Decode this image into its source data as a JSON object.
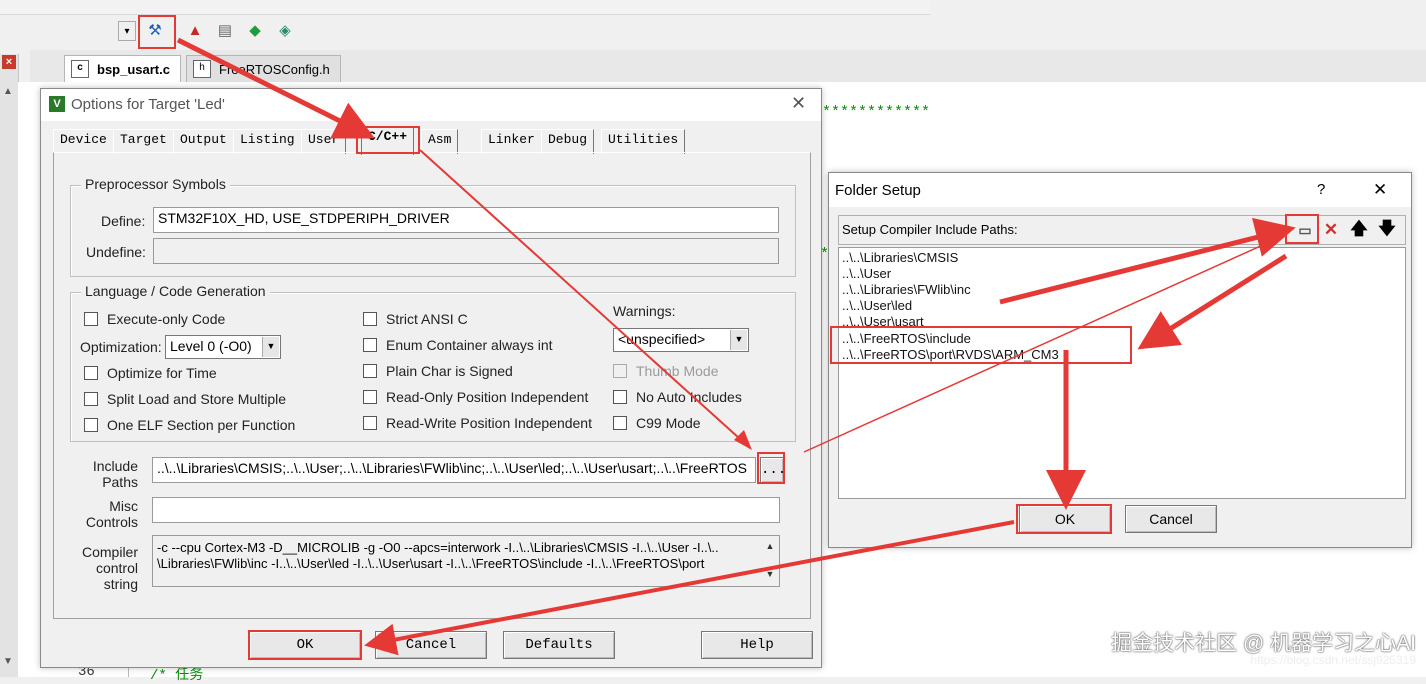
{
  "colors": {
    "annotation_red": "#e53935",
    "comment_green": "#0a8a0a",
    "dialog_bg": "#f0f0f0"
  },
  "toolbar": {
    "icons": [
      "magic-wand-icon",
      "load-icon",
      "layers-icon",
      "green-diamond-icon",
      "manage-packs-icon"
    ]
  },
  "editor_tabs": [
    {
      "label": "bsp_usart.c",
      "active": true
    },
    {
      "label": "FreeRTOSConfig.h",
      "active": false
    }
  ],
  "editor": {
    "stars_line_1": "************",
    "stars_line_2": "*",
    "line_number": "36",
    "comment_text": "/* 任务"
  },
  "options_dialog": {
    "title": "Options for Target 'Led'",
    "tabs": [
      "Device",
      "Target",
      "Output",
      "Listing",
      "User",
      "C/C++",
      "Asm",
      "Linker",
      "Debug",
      "Utilities"
    ],
    "active_tab": "C/C++",
    "preprocessor": {
      "group_title": "Preprocessor Symbols",
      "define_label": "Define:",
      "define_value": "STM32F10X_HD, USE_STDPERIPH_DRIVER",
      "undefine_label": "Undefine:",
      "undefine_value": ""
    },
    "language": {
      "group_title": "Language / Code Generation",
      "execute_only": "Execute-only Code",
      "optimization_label": "Optimization:",
      "optimization_value": "Level 0 (-O0)",
      "optimize_time": "Optimize for Time",
      "split_load": "Split Load and Store Multiple",
      "one_elf": "One ELF Section per Function",
      "strict_ansi": "Strict ANSI C",
      "enum_container": "Enum Container always int",
      "plain_char": "Plain Char is Signed",
      "ro_pi": "Read-Only Position Independent",
      "rw_pi": "Read-Write Position Independent",
      "warnings_label": "Warnings:",
      "warnings_value": "<unspecified>",
      "thumb_mode": "Thumb Mode",
      "no_auto_includes": "No Auto Includes",
      "c99_mode": "C99 Mode"
    },
    "include_paths_label_1": "Include",
    "include_paths_label_2": "Paths",
    "include_paths_value": "..\\..\\Libraries\\CMSIS;..\\..\\User;..\\..\\Libraries\\FWlib\\inc;..\\..\\User\\led;..\\..\\User\\usart;..\\..\\FreeRTOS",
    "browse_label": "...",
    "misc_label_1": "Misc",
    "misc_label_2": "Controls",
    "misc_value": "",
    "compiler_label_1": "Compiler",
    "compiler_label_2": "control",
    "compiler_label_3": "string",
    "compiler_line_1": "-c --cpu Cortex-M3 -D__MICROLIB -g -O0 --apcs=interwork -I..\\..\\Libraries\\CMSIS -I..\\..\\User -I..\\..",
    "compiler_line_2": "\\Libraries\\FWlib\\inc -I..\\..\\User\\led -I..\\..\\User\\usart -I..\\..\\FreeRTOS\\include -I..\\..\\FreeRTOS\\port",
    "buttons": {
      "ok": "OK",
      "cancel": "Cancel",
      "defaults": "Defaults",
      "help": "Help"
    }
  },
  "folder_dialog": {
    "title": "Folder Setup",
    "help": "?",
    "close": "✕",
    "list_label": "Setup Compiler Include Paths:",
    "tool_icons": [
      "new-folder-icon",
      "delete-icon",
      "move-up-icon",
      "move-down-icon"
    ],
    "paths": [
      "..\\..\\Libraries\\CMSIS",
      "..\\..\\User",
      "..\\..\\Libraries\\FWlib\\inc",
      "..\\..\\User\\led",
      "..\\..\\User\\usart",
      "..\\..\\FreeRTOS\\include",
      "..\\..\\FreeRTOS\\port\\RVDS\\ARM_CM3"
    ],
    "buttons": {
      "ok": "OK",
      "cancel": "Cancel"
    }
  },
  "watermark": {
    "text": "掘金技术社区 @ 机器学习之心AI",
    "url": "https://blog.csdn.net/ssj925319"
  }
}
